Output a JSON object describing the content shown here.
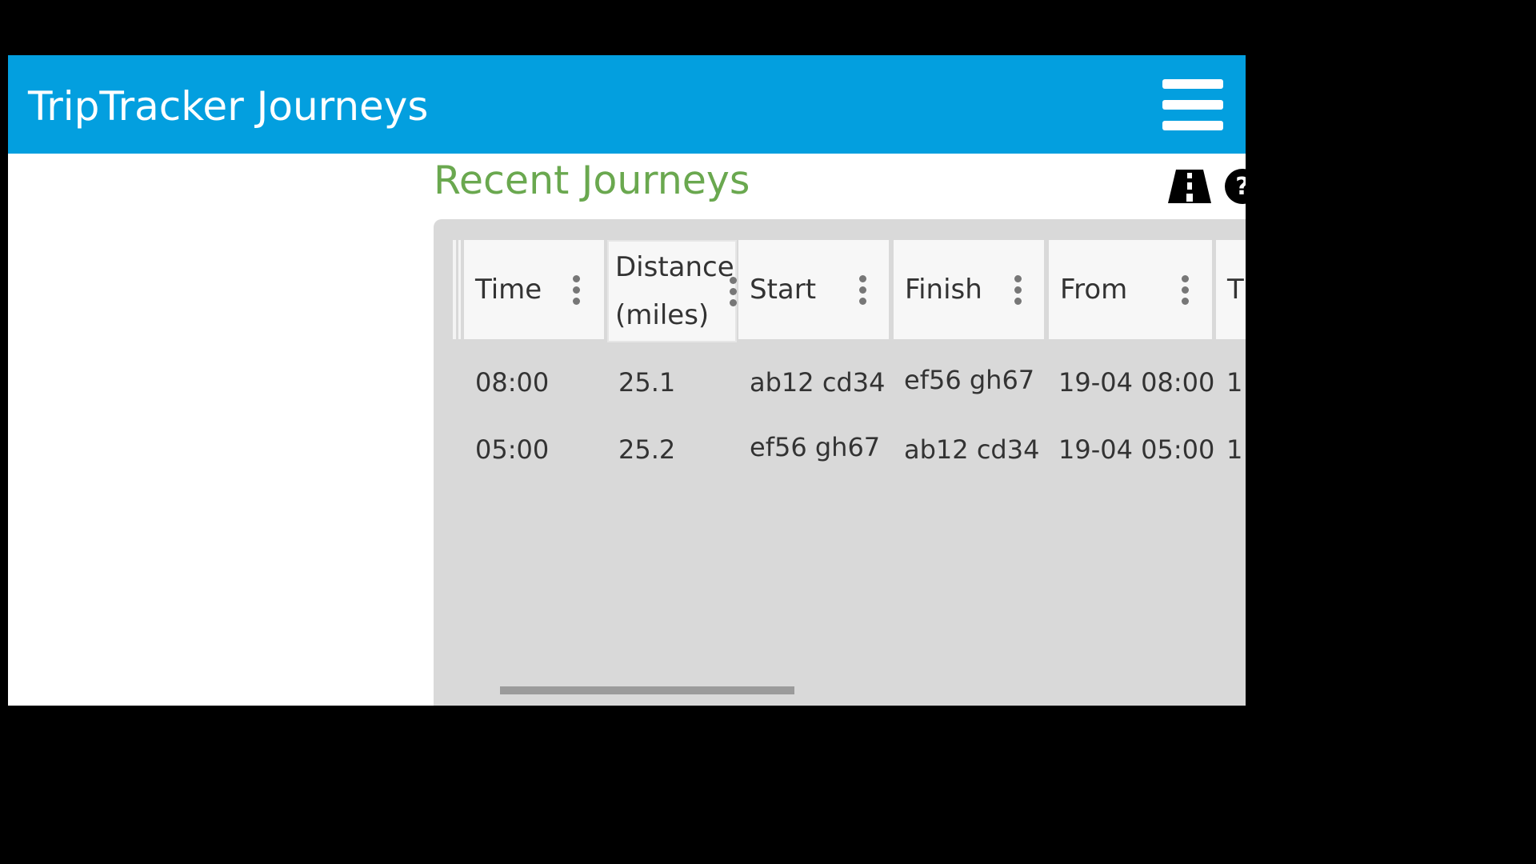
{
  "app": {
    "title": "TripTracker Journeys"
  },
  "icons": {
    "menu": "hamburger-menu-icon",
    "road": "road-icon",
    "help": "help-circle-icon"
  },
  "colors": {
    "appbar": "#039fdf",
    "section_title": "#6aa84f",
    "grid_bg": "#d9d9d9"
  },
  "section": {
    "title": "Recent Journeys"
  },
  "grid": {
    "columns": [
      "Time",
      "Distance (miles)",
      "Start",
      "Finish",
      "From",
      "T"
    ],
    "rows": [
      [
        "08:00",
        "25.1",
        "ab12 cd34",
        "ef56 gh67",
        "19-04 08:00",
        "1"
      ],
      [
        "05:00",
        "25.2",
        "ef56 gh67",
        "ab12 cd34",
        "19-04 05:00",
        "1"
      ]
    ]
  }
}
